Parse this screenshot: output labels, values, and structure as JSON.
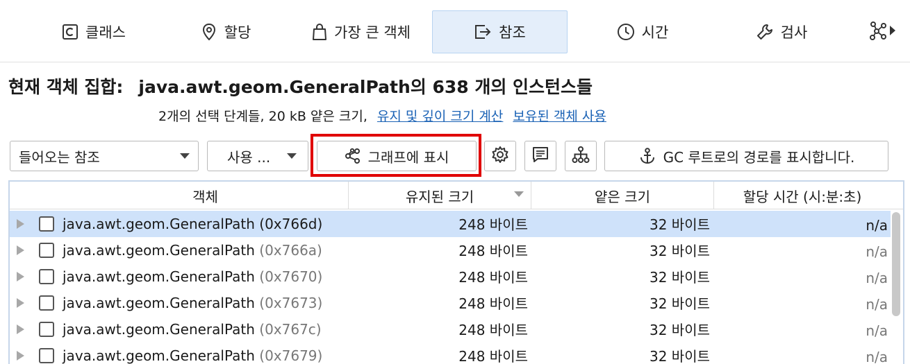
{
  "tabs": [
    {
      "key": "classes",
      "label": "클래스",
      "icon": "class-icon"
    },
    {
      "key": "allocations",
      "label": "할당",
      "icon": "location-pin-icon"
    },
    {
      "key": "biggest",
      "label": "가장 큰 객체",
      "icon": "shopping-bag-icon"
    },
    {
      "key": "references",
      "label": "참조",
      "icon": "reference-arrow-icon",
      "active": true
    },
    {
      "key": "time",
      "label": "시간",
      "icon": "clock-icon"
    },
    {
      "key": "inspections",
      "label": "검사",
      "icon": "wrench-icon"
    }
  ],
  "title": {
    "label": "현재 객체 집합:",
    "value": "java.awt.geom.GeneralPath의 638 개의 인스턴스들"
  },
  "subtitle": {
    "text": "2개의 선택 단계들, 20 kB 얕은 크기,",
    "link_retained": "유지 및 깊이 크기 계산",
    "link_held": "보유된 객체 사용"
  },
  "toolbar": {
    "incoming_refs": "들어오는 참조",
    "use": "사용 ...",
    "show_graph": "그래프에 표시",
    "gc_roots": "GC 루트로의 경로를 표시합니다."
  },
  "table": {
    "headers": {
      "object": "객체",
      "retained": "유지된 크기",
      "shallow": "얕은 크기",
      "alloc_time": "할당 시간 (시:분:초)"
    },
    "rows": [
      {
        "class": "java.awt.geom.GeneralPath",
        "addr": "(0x766d)",
        "retained": "248 바이트",
        "shallow": "32 바이트",
        "alloc": "n/a",
        "selected": true
      },
      {
        "class": "java.awt.geom.GeneralPath",
        "addr": "(0x766a)",
        "retained": "248 바이트",
        "shallow": "32 바이트",
        "alloc": "n/a"
      },
      {
        "class": "java.awt.geom.GeneralPath",
        "addr": "(0x7670)",
        "retained": "248 바이트",
        "shallow": "32 바이트",
        "alloc": "n/a"
      },
      {
        "class": "java.awt.geom.GeneralPath",
        "addr": "(0x7673)",
        "retained": "248 바이트",
        "shallow": "32 바이트",
        "alloc": "n/a"
      },
      {
        "class": "java.awt.geom.GeneralPath",
        "addr": "(0x767c)",
        "retained": "248 바이트",
        "shallow": "32 바이트",
        "alloc": "n/a"
      },
      {
        "class": "java.awt.geom.GeneralPath",
        "addr": "(0x7679)",
        "retained": "248 바이트",
        "shallow": "32 바이트",
        "alloc": "n/a"
      }
    ]
  },
  "colors": {
    "accent": "#1a62b5",
    "active_tab_bg": "#e4eefa",
    "selected_row_bg": "#cfe2fa",
    "highlight_box": "#e00000"
  }
}
